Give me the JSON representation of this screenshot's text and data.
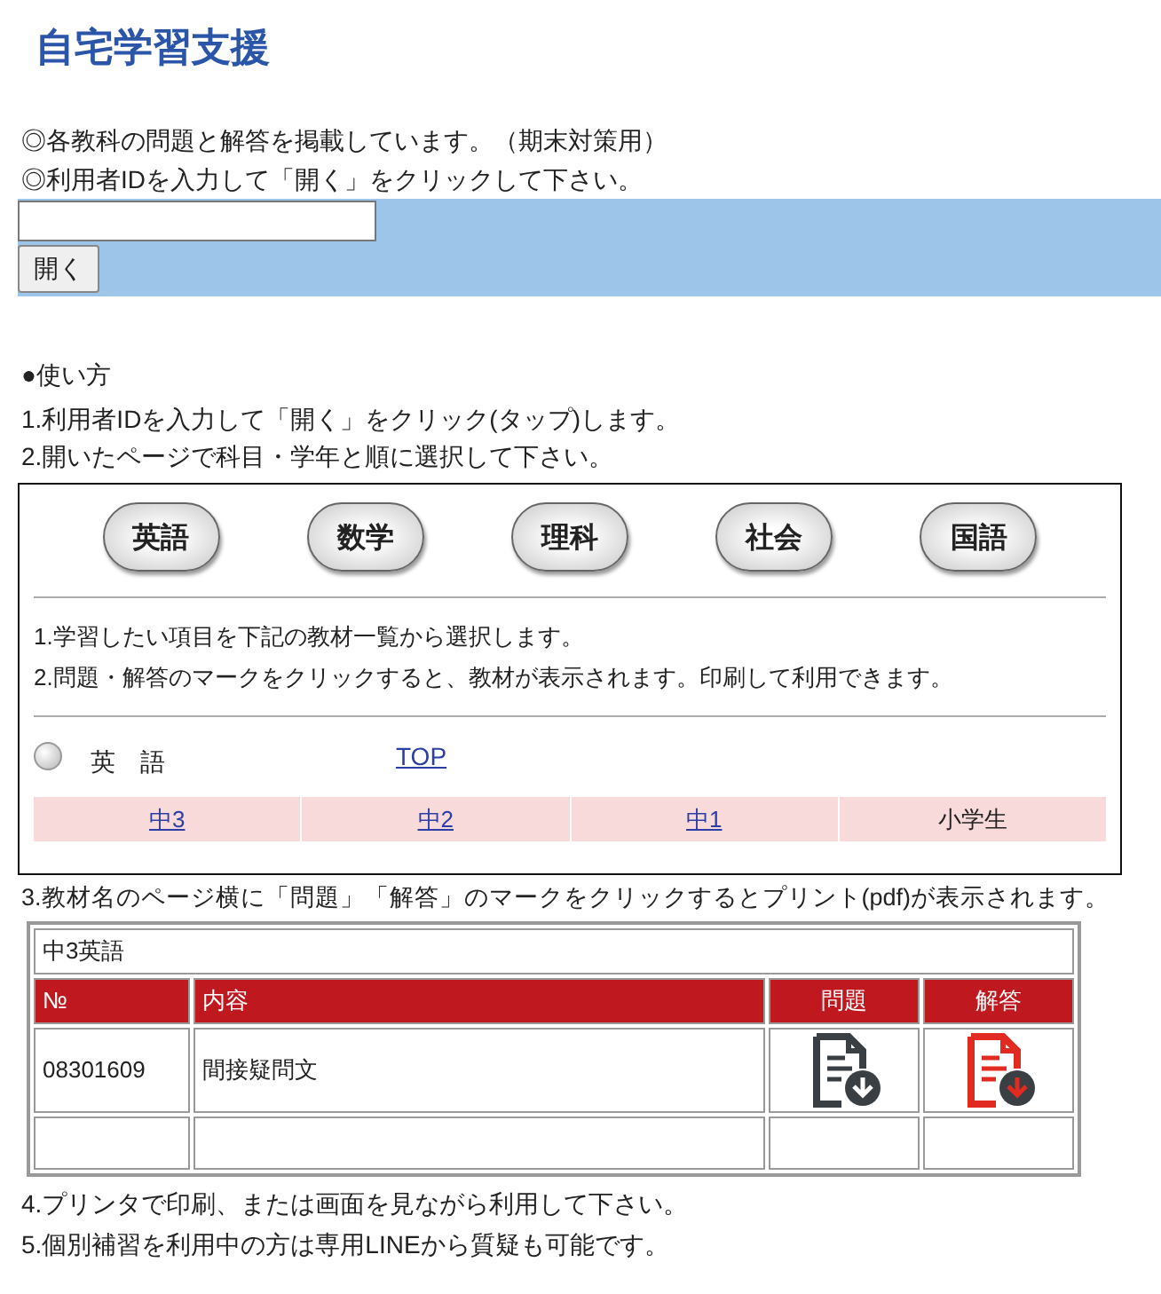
{
  "title": "自宅学習支援",
  "notes": [
    "◎各教科の問題と解答を掲載しています。（期末対策用）",
    "◎利用者IDを入力して「開く」をクリックして下さい。"
  ],
  "open_button": "開く",
  "how_to": {
    "heading": "●使い方",
    "steps_before": [
      "1.利用者IDを入力して「開く」をクリック(タップ)します。",
      "2.開いたページで科目・学年と順に選択して下さい。"
    ]
  },
  "sample_page": {
    "subject_buttons": [
      "英語",
      "数学",
      "理科",
      "社会",
      "国語"
    ],
    "instructions": [
      "1.学習したい項目を下記の教材一覧から選択します。",
      "2.問題・解答のマークをクリックすると、教材が表示されます。印刷して利用できます。"
    ],
    "subject": {
      "label": "英　語",
      "selected": false,
      "link": "TOP"
    },
    "grade_tabs": [
      {
        "label": "中3",
        "kind": "link"
      },
      {
        "label": "中2",
        "kind": "link"
      },
      {
        "label": "中1",
        "kind": "link"
      },
      {
        "label": "小学生",
        "kind": "text"
      }
    ]
  },
  "step3": "3.教材名のページ横に「問題」「解答」のマークをクリックするとプリント(pdf)が表示されます。",
  "table": {
    "caption": "中3英語",
    "columns": [
      "№",
      "内容",
      "問題",
      "解答"
    ],
    "rows": [
      {
        "kind": "item",
        "cells": [
          "08301609",
          "間接疑問文"
        ]
      },
      {
        "kind": "blank"
      }
    ]
  },
  "steps_after": [
    "4.プリンタで印刷、または画面を見ながら利用して下さい。",
    "5.個別補習を利用中の方は専用LINEから質疑も可能です。"
  ]
}
